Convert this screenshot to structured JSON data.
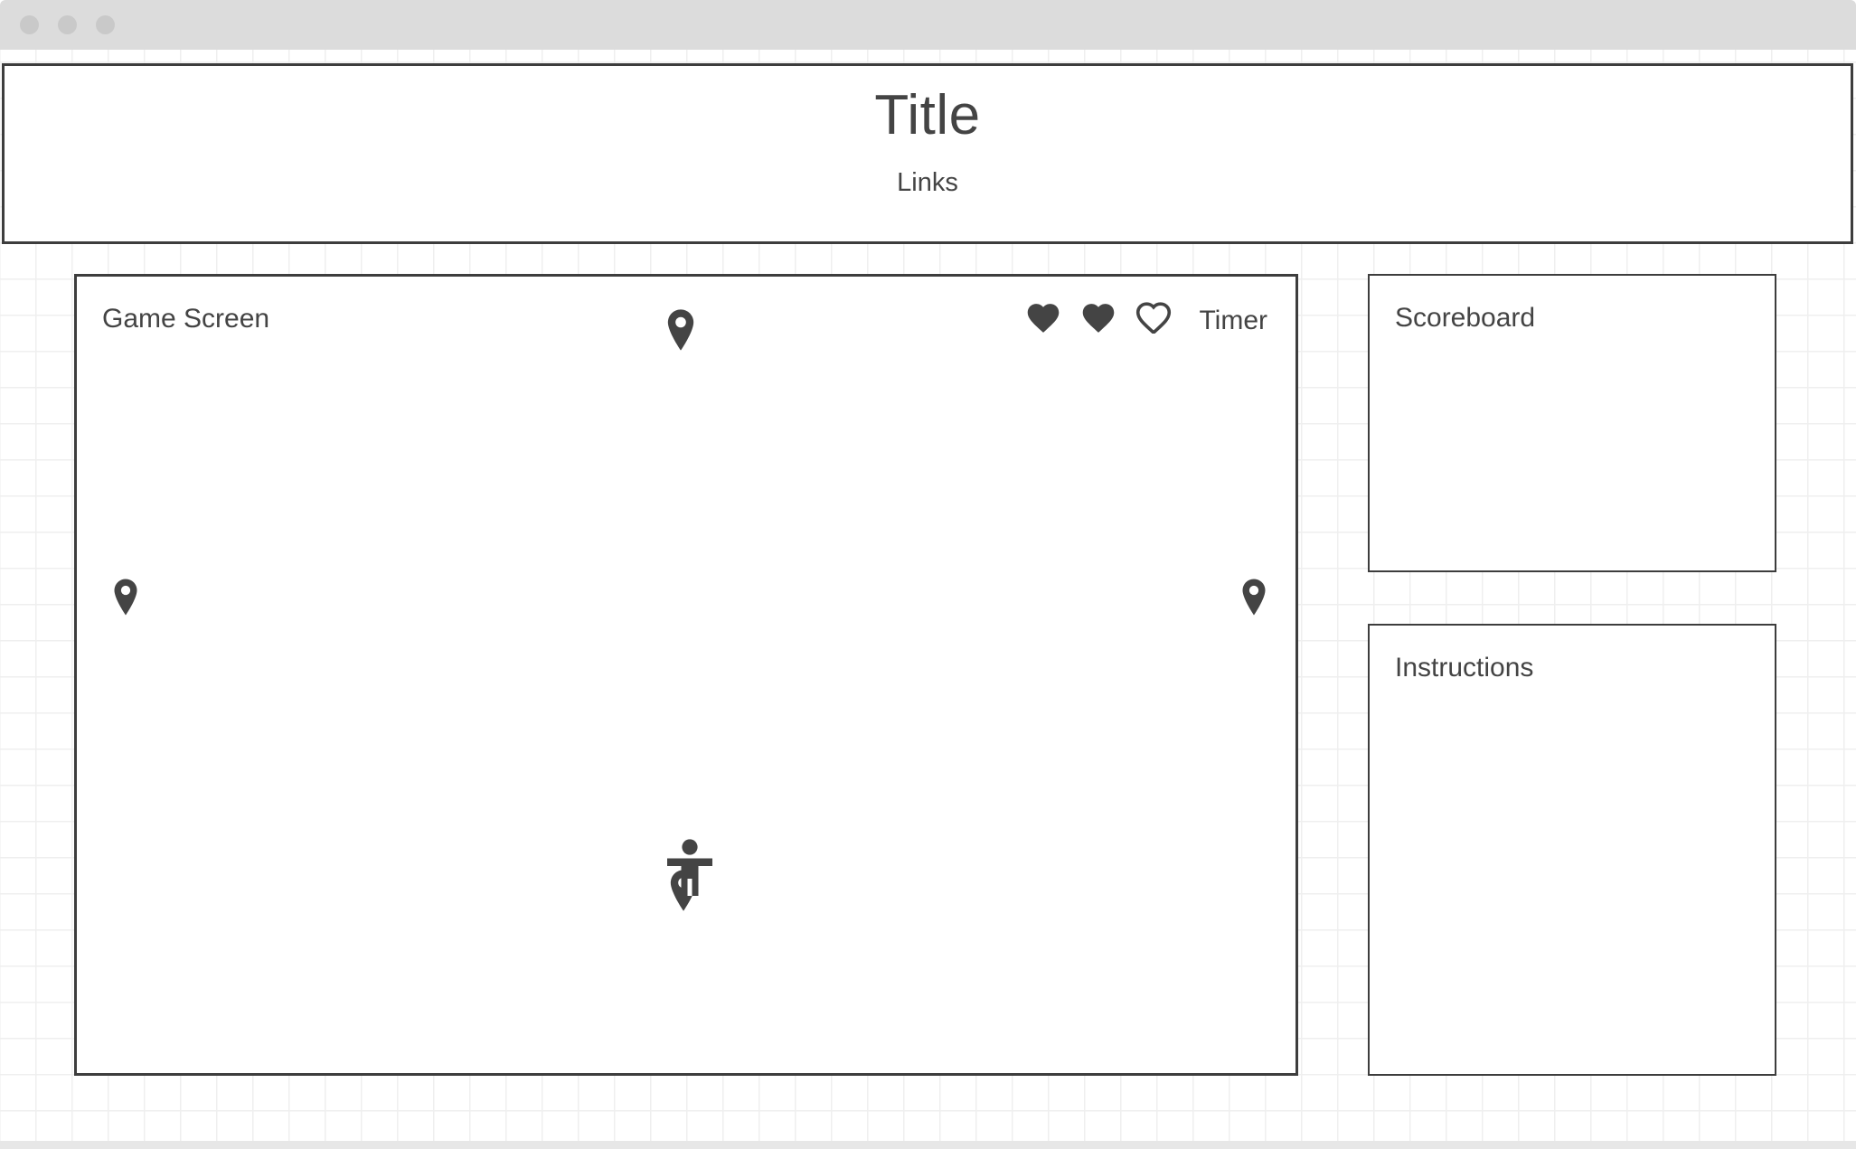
{
  "window": {
    "chrome": {
      "dots": [
        "window-dot-1",
        "window-dot-2",
        "window-dot-3"
      ],
      "bar_color": "#dcdcdc",
      "dot_color": "#c9c9c9"
    }
  },
  "header": {
    "title": "Title",
    "links": "Links"
  },
  "game_screen": {
    "label": "Game Screen",
    "timer_label": "Timer",
    "lives": {
      "total": 3,
      "remaining": 2,
      "icons": [
        "heart-filled-icon",
        "heart-filled-icon",
        "heart-outline-icon"
      ]
    },
    "markers": [
      {
        "name": "map-pin-top-icon",
        "position": "top-center"
      },
      {
        "name": "map-pin-left-icon",
        "position": "middle-left"
      },
      {
        "name": "map-pin-right-icon",
        "position": "middle-right"
      },
      {
        "name": "map-pin-bottom-icon",
        "position": "bottom-center"
      }
    ],
    "player": {
      "icon": "player-figure-icon",
      "position": "center"
    }
  },
  "sidebar": {
    "scoreboard": {
      "label": "Scoreboard"
    },
    "instructions": {
      "label": "Instructions"
    }
  },
  "theme": {
    "ink": "#3d3d3d",
    "text": "#444444",
    "panel_bg": "#ffffff",
    "grid_line": "#efefef",
    "page_bg": "#ffffff"
  }
}
